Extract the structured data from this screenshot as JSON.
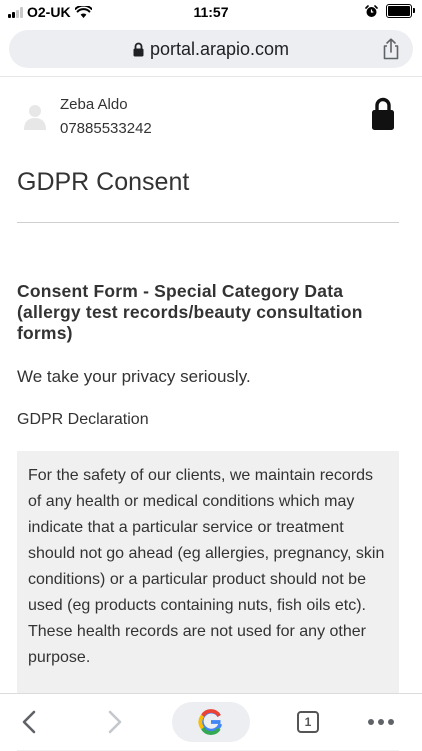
{
  "status_bar": {
    "carrier": "O2-UK",
    "time": "11:57",
    "signal_bars": 4,
    "signal_bars_active": 2,
    "battery_level": 1.0
  },
  "browser": {
    "url": "portal.arapio.com",
    "tab_count": "1",
    "icons": [
      "lock-icon",
      "share-icon",
      "back-icon",
      "forward-icon",
      "google-icon",
      "more-icon"
    ]
  },
  "profile": {
    "name": "Zeba Aldo",
    "phone": "07885533242"
  },
  "page": {
    "title": "GDPR Consent",
    "form_title": "Consent Form - Special Category Data (allergy test records/beauty consultation forms)",
    "privacy_text": "We take your privacy seriously.",
    "declaration_heading": "GDPR Declaration",
    "declaration_body_1": "For the safety of our clients, we maintain records of any health or medical conditions which may indicate that a particular service or treatment should not go ahead (eg allergies, pregnancy, skin conditions) or a particular product should not be used (eg products containing nuts, fish oils etc).",
    "declaration_body_2": "These health records are not used for any other purpose."
  },
  "colors": {
    "url_bar_bg": "#eceef1",
    "declaration_bg": "#f0f0f0",
    "text": "#333333",
    "google_blue": "#4285F4",
    "google_red": "#EA4335",
    "google_yellow": "#FBBC05",
    "google_green": "#34A853"
  }
}
